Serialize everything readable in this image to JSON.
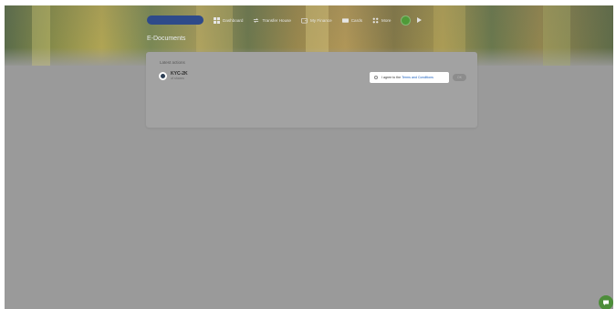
{
  "hero": {
    "title": "E-Documents"
  },
  "nav": {
    "user_label": "",
    "items": [
      {
        "label": "Dashboard",
        "icon": "grid-icon"
      },
      {
        "label": "Transfer House",
        "icon": "swap-icon"
      },
      {
        "label": "My Finance",
        "icon": "wallet-icon"
      },
      {
        "label": "Cards",
        "icon": "card-icon"
      },
      {
        "label": "More",
        "icon": "apps-icon"
      }
    ]
  },
  "card": {
    "header": "Latest actions",
    "document": {
      "title": "KYC-2K",
      "subtitle": "",
      "suffix": "of shares"
    },
    "agreement": {
      "prefix": "I agree to the",
      "link": "Terms and Conditions"
    },
    "ok_button": "OK"
  },
  "colors": {
    "overlay": "#9a9a9a",
    "accent_green": "#4f9a38",
    "nav_pill": "#2e4a8a",
    "link_blue": "#1a5fbf"
  }
}
